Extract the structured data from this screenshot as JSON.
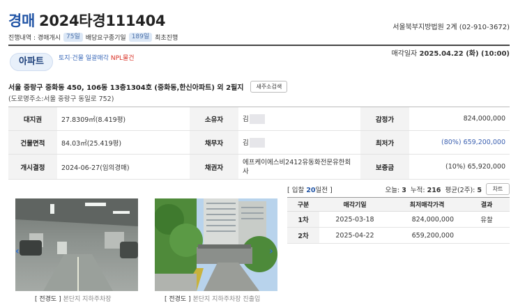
{
  "header": {
    "kind": "경매",
    "case_no": "2024타경111404",
    "court": "서울북부지방법원 2계 (02-910-3672)",
    "progress_label": "진행내역 : 경매개시",
    "progress_days": "75일",
    "claim_label": "배당요구종기일",
    "claim_days": "189일",
    "first_label": "최초진행"
  },
  "badge": {
    "type": "아파트",
    "tag1": "토지·건물 일괄매각",
    "tag2": "NPL물건"
  },
  "sale_date": {
    "label": "매각일자",
    "value": "2025.04.22 (화) (10:00)"
  },
  "address": {
    "full": "서울 중랑구 중화동 450, 106동 13층1304호 (중화동,한신아파트) 외 2필지",
    "button": "새주소검색",
    "road": "(도로명주소:서울 중랑구 동일로 752)"
  },
  "info": {
    "land_label": "대지권",
    "land_value": "27.8309㎡(8.419평)",
    "owner_label": "소유자",
    "owner_value": "김",
    "appraisal_label": "감정가",
    "appraisal_value": "824,000,000",
    "area_label": "건물면적",
    "area_value": "84.03㎡(25.419평)",
    "debtor_label": "채무자",
    "debtor_value": "김",
    "min_label": "최저가",
    "min_value": "(80%) 659,200,000",
    "start_label": "개시결정",
    "start_value": "2024-06-27(임의경매)",
    "creditor_label": "채권자",
    "creditor_value": "에프케이에스비2412유동화전문유한회사",
    "deposit_label": "보증금",
    "deposit_value": "(10%) 65,920,000"
  },
  "photos": [
    {
      "tag": "[ 전경도 ]",
      "desc": "본단지 지하주차장"
    },
    {
      "tag": "[ 전경도 ]",
      "desc": "본단지 지하주차장 진출입"
    }
  ],
  "stats": {
    "interest_pre": "[ 입찰 ",
    "interest_days": "20",
    "interest_post": "일전 ]",
    "today_label": "오늘: ",
    "today_value": "3",
    "total_label": "누적: ",
    "total_value": "216",
    "avg_label": "평균(2주): ",
    "avg_value": "5",
    "chart_button": "차트"
  },
  "history": {
    "headers": [
      "구분",
      "매각기일",
      "최저매각가격",
      "결과"
    ],
    "rows": [
      {
        "round": "1차",
        "date": "2025-03-18",
        "price": "824,000,000",
        "result": "유찰"
      },
      {
        "round": "2차",
        "date": "2025-04-22",
        "price": "659,200,000",
        "result": ""
      }
    ]
  },
  "colors": {
    "accent": "#2255a6",
    "npl": "#d93025",
    "pill_bg": "#dbe7f6"
  }
}
